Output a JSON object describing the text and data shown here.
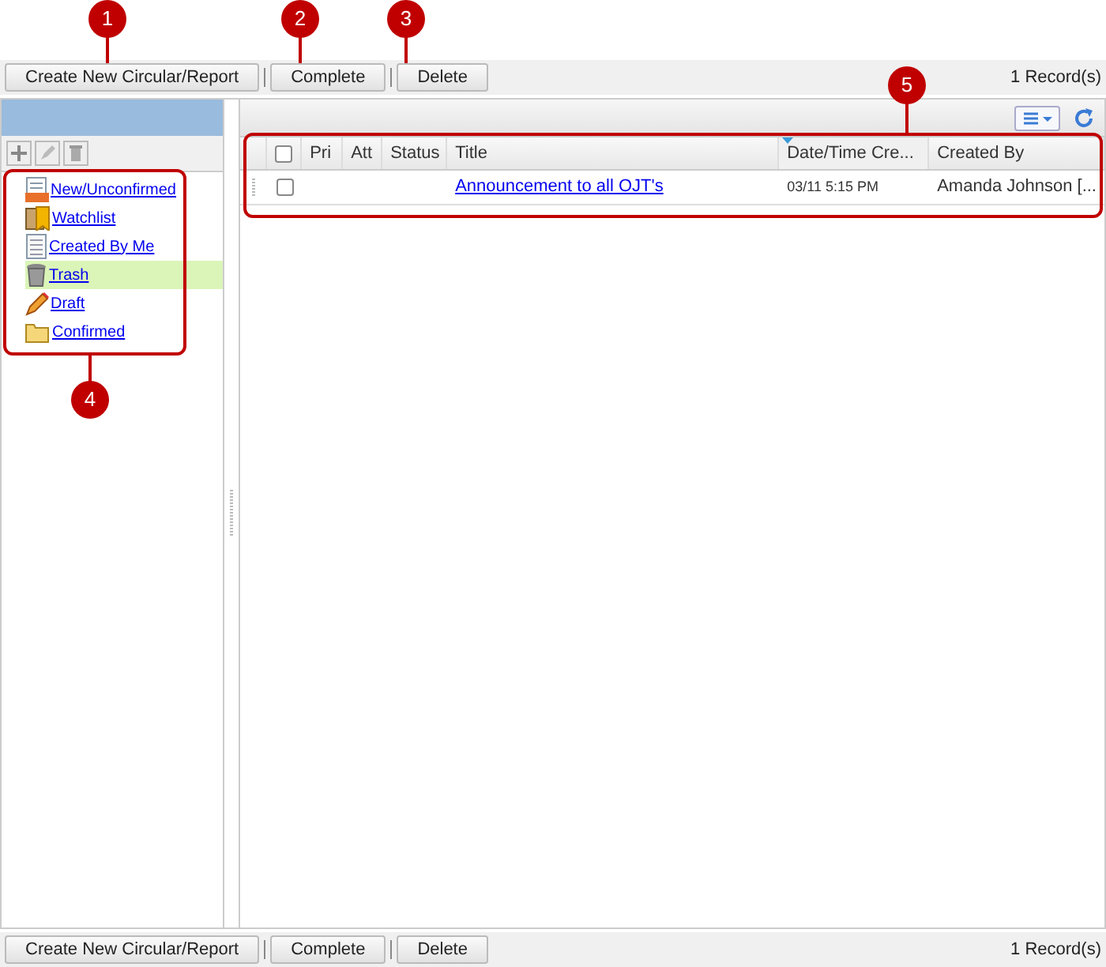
{
  "toolbar_top": {
    "buttons": [
      "Create New Circular/Report",
      "Complete",
      "Delete"
    ],
    "record_count": "1 Record(s)"
  },
  "sidebar": {
    "items": [
      {
        "label": "New/Unconfirmed",
        "kind": "new",
        "selected": false
      },
      {
        "label": "Watchlist",
        "kind": "watch",
        "selected": false
      },
      {
        "label": "Created By Me",
        "kind": "doc",
        "selected": false
      },
      {
        "label": "Trash",
        "kind": "trash",
        "selected": true
      },
      {
        "label": "Draft",
        "kind": "draft",
        "selected": false
      },
      {
        "label": "Confirmed",
        "kind": "folder",
        "selected": false
      }
    ]
  },
  "table": {
    "select_all_checked": false,
    "columns": [
      {
        "label": "Pri",
        "sorted": false
      },
      {
        "label": "Att",
        "sorted": false
      },
      {
        "label": "Status",
        "sorted": false
      },
      {
        "label": "Title",
        "sorted": false
      },
      {
        "label": "Date/Time Cre...",
        "sorted": true
      },
      {
        "label": "Created By",
        "sorted": false
      }
    ],
    "rows": [
      {
        "checked": false,
        "title": "Announcement to all OJT's",
        "date": "03/11 5:15 PM",
        "created_by": "Amanda Johnson [..."
      }
    ]
  },
  "toolbar_bottom": {
    "buttons": [
      "Create New Circular/Report",
      "Complete",
      "Delete"
    ],
    "record_count": "1 Record(s)"
  },
  "callouts": [
    "1",
    "2",
    "3",
    "4",
    "5"
  ]
}
